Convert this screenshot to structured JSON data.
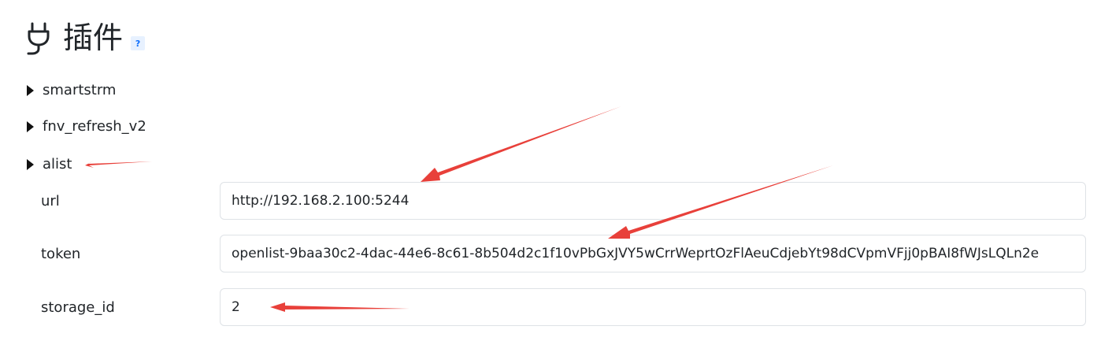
{
  "header": {
    "title": "插件",
    "help_label": "?",
    "icon": "plug-icon"
  },
  "plugins": [
    {
      "name": "smartstrm",
      "expanded": false
    },
    {
      "name": "fnv_refresh_v2",
      "expanded": false
    },
    {
      "name": "alist",
      "expanded": true
    }
  ],
  "alist": {
    "fields": [
      {
        "label": "url",
        "value": "http://192.168.2.100:5244"
      },
      {
        "label": "token",
        "value": "openlist-9baa30c2-4dac-44e6-8c61-8b504d2c1f10vPbGxJVY5wCrrWeprtOzFlAeuCdjebYt98dCVpmVFjj0pBAI8fWJsLQLn2e"
      },
      {
        "label": "storage_id",
        "value": "2"
      }
    ]
  },
  "colors": {
    "annotation_arrow": "#e8403a",
    "help_badge_text": "#0d6efd",
    "input_border": "#dee2e6"
  }
}
